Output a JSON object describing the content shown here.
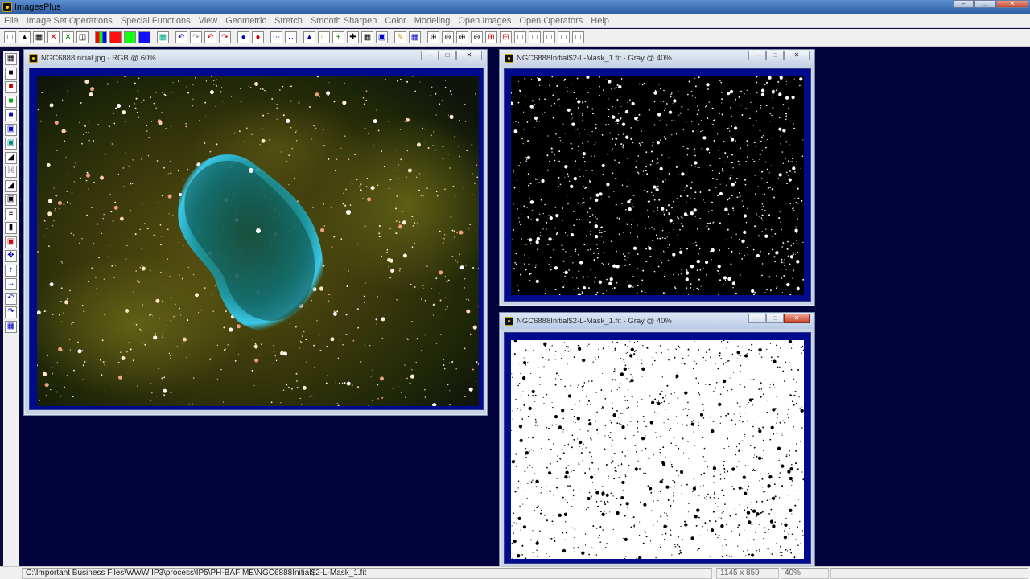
{
  "app": {
    "title": "ImagesPlus"
  },
  "menu": [
    "File",
    "Image Set Operations",
    "Special Functions",
    "View",
    "Geometric",
    "Stretch",
    "Smooth Sharpen",
    "Color",
    "Modeling",
    "Open Images",
    "Open Operators",
    "Help"
  ],
  "windows": {
    "rgb": {
      "title": "NGC6888Initial.jpg - RGB @ 60%"
    },
    "mask_black": {
      "title": "NGC6888Initial$2-L-Mask_1.fit - Gray @ 40%"
    },
    "mask_white": {
      "title": "NGC6888Initial$2-L-Mask_1.fit - Gray @ 40%"
    }
  },
  "status": {
    "path": "C:\\Important Business Files\\WWW IP3\\process\\IP5\\PH-BAFIME\\NGC6888Initial$2-L-Mask_1.fit",
    "dimensions": "1145 x 859",
    "zoom": "40%"
  },
  "colors": {
    "desktop": "#02023d",
    "image_frame": "#000a8c",
    "nebula_teal": "#26b4c8",
    "nebula_background": "#5a4a10"
  }
}
